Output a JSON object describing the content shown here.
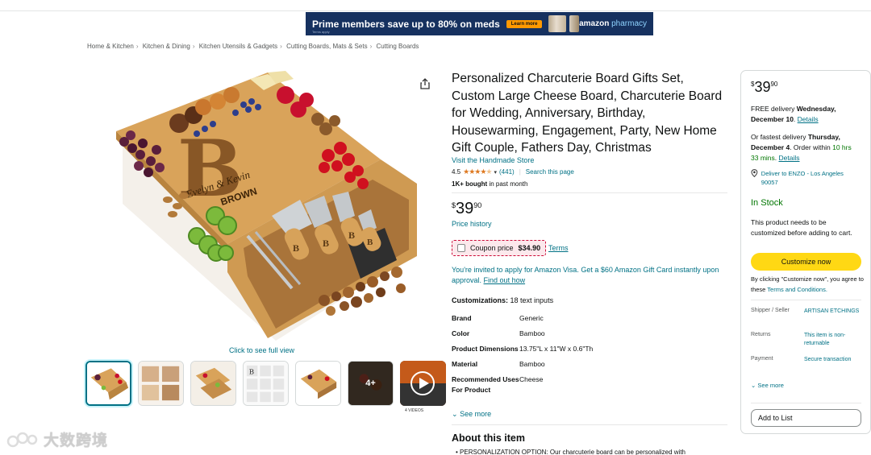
{
  "banner": {
    "headline": "Prime members save up to 80% on meds",
    "sub": "Terms apply",
    "cta": "Learn more",
    "brand": "amazon",
    "brand_sub": "pharmacy"
  },
  "breadcrumb": [
    "Home & Kitchen",
    "Kitchen & Dining",
    "Kitchen Utensils & Gadgets",
    "Cutting Boards, Mats & Sets",
    "Cutting Boards"
  ],
  "gallery": {
    "click_full_view": "Click to see full view",
    "more_count": "4+",
    "videos_label": "4 VIDEOS",
    "board_names": "Evelyn & Kevin",
    "board_surname": "BROWN",
    "board_letter": "B"
  },
  "product": {
    "title": "Personalized Charcuterie Board Gifts Set, Custom Large Cheese Board, Charcuterie Board for Wedding, Anniversary, Birthday, Housewarming, Engagement, Party, New Home Gift Couple, Fathers Day, Christmas",
    "store": "Visit the Handmade Store",
    "rating": "4.5",
    "reviews": "(441)",
    "search_page": "Search this page",
    "bought_bold": "1K+ bought",
    "bought_rest": " in past month",
    "price_symbol": "$",
    "price_whole": "39",
    "price_fraction": "90",
    "price_history": "Price history",
    "coupon_label": "Coupon price",
    "coupon_price": "$34.90",
    "coupon_terms": "Terms",
    "visa_text": "You're invited to apply for Amazon Visa. Get a $60 Amazon Gift Card instantly upon approval.",
    "visa_link": "Find out how",
    "customizations_label": "Customizations:",
    "customizations_value": "18 text inputs",
    "specs": [
      {
        "k": "Brand",
        "v": "Generic"
      },
      {
        "k": "Color",
        "v": "Bamboo"
      },
      {
        "k": "Product Dimensions",
        "v": "13.75\"L x 11\"W x 0.6\"Th"
      },
      {
        "k": "Material",
        "v": "Bamboo"
      },
      {
        "k": "Recommended Uses For Product",
        "v": "Cheese"
      }
    ],
    "see_more": "See more",
    "about_heading": "About this item",
    "about_first": "PERSONALIZATION OPTION: Our charcuterie board can be personalized with"
  },
  "buybox": {
    "price_symbol": "$",
    "price_whole": "39",
    "price_fraction": "90",
    "delivery_pre": "FREE delivery ",
    "delivery_date": "Wednesday, December 10",
    "delivery_link": "Details",
    "fastest_pre": "Or fastest delivery ",
    "fastest_date": "Thursday, December 4",
    "order_within": ". Order within ",
    "countdown": "10 hrs 33 mins",
    "fastest_link": "Details",
    "deliver_to": "Deliver to ENZO - Los Angeles 90057",
    "stock": "In Stock",
    "custom_note": "This product needs to be customized before adding to cart.",
    "customize_btn": "Customize now",
    "agree_pre": "By clicking \"Customize now\", you agree to these ",
    "agree_link": "Terms and Conditions.",
    "shipper_label": "Shipper / Seller",
    "shipper_value": "ARTISAN ETCHINGS",
    "returns_label": "Returns",
    "returns_value": "This item is non-returnable",
    "payment_label": "Payment",
    "payment_value": "Secure transaction",
    "see_more": "See more",
    "add_to_list": "Add to List"
  },
  "watermark": "大数跨境",
  "colors": {
    "link": "#007185",
    "customize_button": "#ffd814",
    "in_stock": "#007600",
    "coupon_border": "#cc0c39",
    "stars": "#de7921",
    "banner_bg": "#16315f"
  }
}
